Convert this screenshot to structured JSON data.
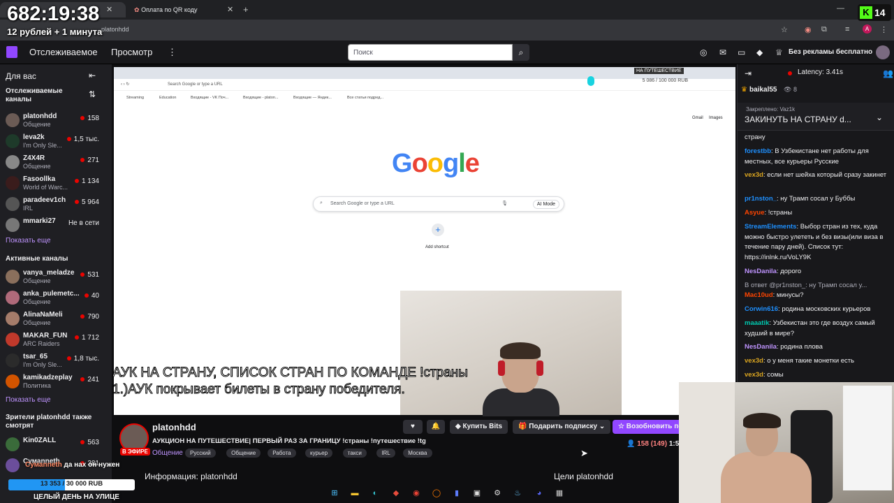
{
  "overlay": {
    "timer": "682:19:38",
    "price": "12 рублей + 1 минута",
    "kick_count": "14",
    "goal_text": "13 353 / 30 000 RUB",
    "goal_current": 13353,
    "goal_total": 30000,
    "bottom_text": "ЦЕЛЫЙ ДЕНЬ НА УЛИЦЕ",
    "chat_overlay": "да нах он нужен",
    "chat_overlay_user": "Сумаnneth",
    "subtitle_line1": "АУК НА СТРАНУ, СПИСОК СТРАН ПО КОМАНДЕ !страны",
    "subtitle_line2": "1.)АУК покрывает билеты в страну победителя.",
    "donation_top": "НА ПУТЕШЕСТВИЕ",
    "donation_progress": "5 086 / 100 000 RUB"
  },
  "browser": {
    "tab2_label": "Оплата по QR коду",
    "address": "platonhdd"
  },
  "topnav": {
    "following": "Отслеживаемое",
    "browse": "Просмотр",
    "search_placeholder": "Поиск",
    "no_ads": "Без рекламы бесплатно"
  },
  "sidebar": {
    "for_you": "Для вас",
    "followed_header": "Отслеживаемые каналы",
    "show_more": "Показать еще",
    "active_header": "Активные каналы",
    "also_watch_header": "Зрители platonhdd также смотрят",
    "followed": [
      {
        "name": "platonhdd",
        "category": "Общение",
        "viewers": "158",
        "color": "#6b5b55"
      },
      {
        "name": "leva2k",
        "category": "I'm Only Sle...",
        "viewers": "1,5 тыс.",
        "color": "#1e3a2a"
      },
      {
        "name": "Z4X4R",
        "category": "Общение",
        "viewers": "271",
        "color": "#888"
      },
      {
        "name": "Fasoollka",
        "category": "World of Warc...",
        "viewers": "1 134",
        "color": "#3a1c1c"
      },
      {
        "name": "paradeev1ch",
        "category": "IRL",
        "viewers": "5 964",
        "color": "#555"
      },
      {
        "name": "mmarki27",
        "category": "",
        "viewers": "Не в сети",
        "color": "#777"
      }
    ],
    "active": [
      {
        "name": "vanya_meladze",
        "category": "Общение",
        "viewers": "531",
        "color": "#8a6f5c"
      },
      {
        "name": "anka_pulemetc...",
        "category": "Общение",
        "viewers": "40",
        "color": "#b06a7a"
      },
      {
        "name": "AlinaNaMeli",
        "category": "Общение",
        "viewers": "790",
        "color": "#a57c6a"
      },
      {
        "name": "MAKAR_FUN",
        "category": "ARC Raiders",
        "viewers": "1 712",
        "color": "#c0392b"
      },
      {
        "name": "tsar_65",
        "category": "I'm Only Sle...",
        "viewers": "1,8 тыс.",
        "color": "#2b2b2b"
      },
      {
        "name": "kamikadzeplay",
        "category": "Политика",
        "viewers": "241",
        "color": "#d35400"
      }
    ],
    "also_watch": [
      {
        "name": "Kin0ZALL",
        "category": "",
        "viewers": "563",
        "color": "#3a6b3a"
      },
      {
        "name": "Сумаnneth",
        "category": "",
        "viewers": "381",
        "color": "#6b4e9b"
      }
    ]
  },
  "video": {
    "search_placeholder": "Search Google or type a URL",
    "ai_mode": "AI Mode",
    "add_shortcut": "Add shortcut",
    "gmail": "Gmail",
    "images": "Images",
    "bookmarks": [
      "Streaming",
      "Education",
      "Входящие - VK Поч...",
      "Входящие - platon...",
      "Входящие — Яндек...",
      "Все статьи подред..."
    ]
  },
  "info": {
    "channel": "platonhdd",
    "live": "В ЭФИРЕ",
    "title": "АУКЦИОН НА ПУТЕШЕСТВИЕ| ПЕРВЫЙ РАЗ ЗА ГРАНИЦУ !страны !путешествие !tg",
    "category": "Общение",
    "tags": [
      "Русский",
      "Общение",
      "Работа",
      "курьер",
      "такси",
      "IRL",
      "Москва"
    ],
    "buy_bits": "Купить Bits",
    "gift_sub": "Подарить подписку",
    "resub": "Возобновить по",
    "viewers": "158 (149)",
    "uptime": "1:5",
    "about": "Информация: platonhdd",
    "goals": "Цели platonhdd"
  },
  "chat": {
    "latency": "Latency: 3.41s",
    "top_user": "baikal55",
    "top_count": "8",
    "pinned_by": "Закреплено: Vaz1k",
    "pinned_text": "ЗАКИНУТЬ НА СТРАНУ d...",
    "messages": [
      {
        "user": "",
        "color": "#efeff1",
        "text": "страну"
      },
      {
        "user": "forestbb",
        "color": "#1e90ff",
        "text": ": В Узбекистане нет работы для местных, все курьеры Русские"
      },
      {
        "user": "vex3d",
        "color": "#daa520",
        "text": ": если нет шейха который сразу закинет"
      },
      {
        "user": "pr1nston_",
        "color": "#1e90ff",
        "text": ": ну Трамп сосал у Буббы"
      },
      {
        "user": "Asyue",
        "color": "#ff4500",
        "text": ": !страны"
      },
      {
        "user": "StreamElements",
        "color": "#1e90ff",
        "text": ": Выбор стран из тех, куда можно быстро улететь и без визы(или виза в течение пару дней). Список тут: https://inlnk.ru/VoLY9K"
      },
      {
        "user": "NesDanila",
        "color": "#bf94ff",
        "text": ": дорого"
      },
      {
        "user": "",
        "color": "#adadb8",
        "text": "В ответ @pr1nston_: ну Трамп сосал у..."
      },
      {
        "user": "Mac10ud",
        "color": "#ff4500",
        "text": ": минусы?"
      },
      {
        "user": "Corwin616",
        "color": "#1e90ff",
        "text": ": родина московских курьеров"
      },
      {
        "user": "maaatik",
        "color": "#00c8af",
        "text": ": Узбекистан это где воздух самый худший в мире?"
      },
      {
        "user": "NesDanila",
        "color": "#bf94ff",
        "text": ": родина плова"
      },
      {
        "user": "vex3d",
        "color": "#daa520",
        "text": ": о у меня такие монетки есть"
      },
      {
        "user": "vex3d",
        "color": "#daa520",
        "text": ": сомы"
      }
    ]
  }
}
